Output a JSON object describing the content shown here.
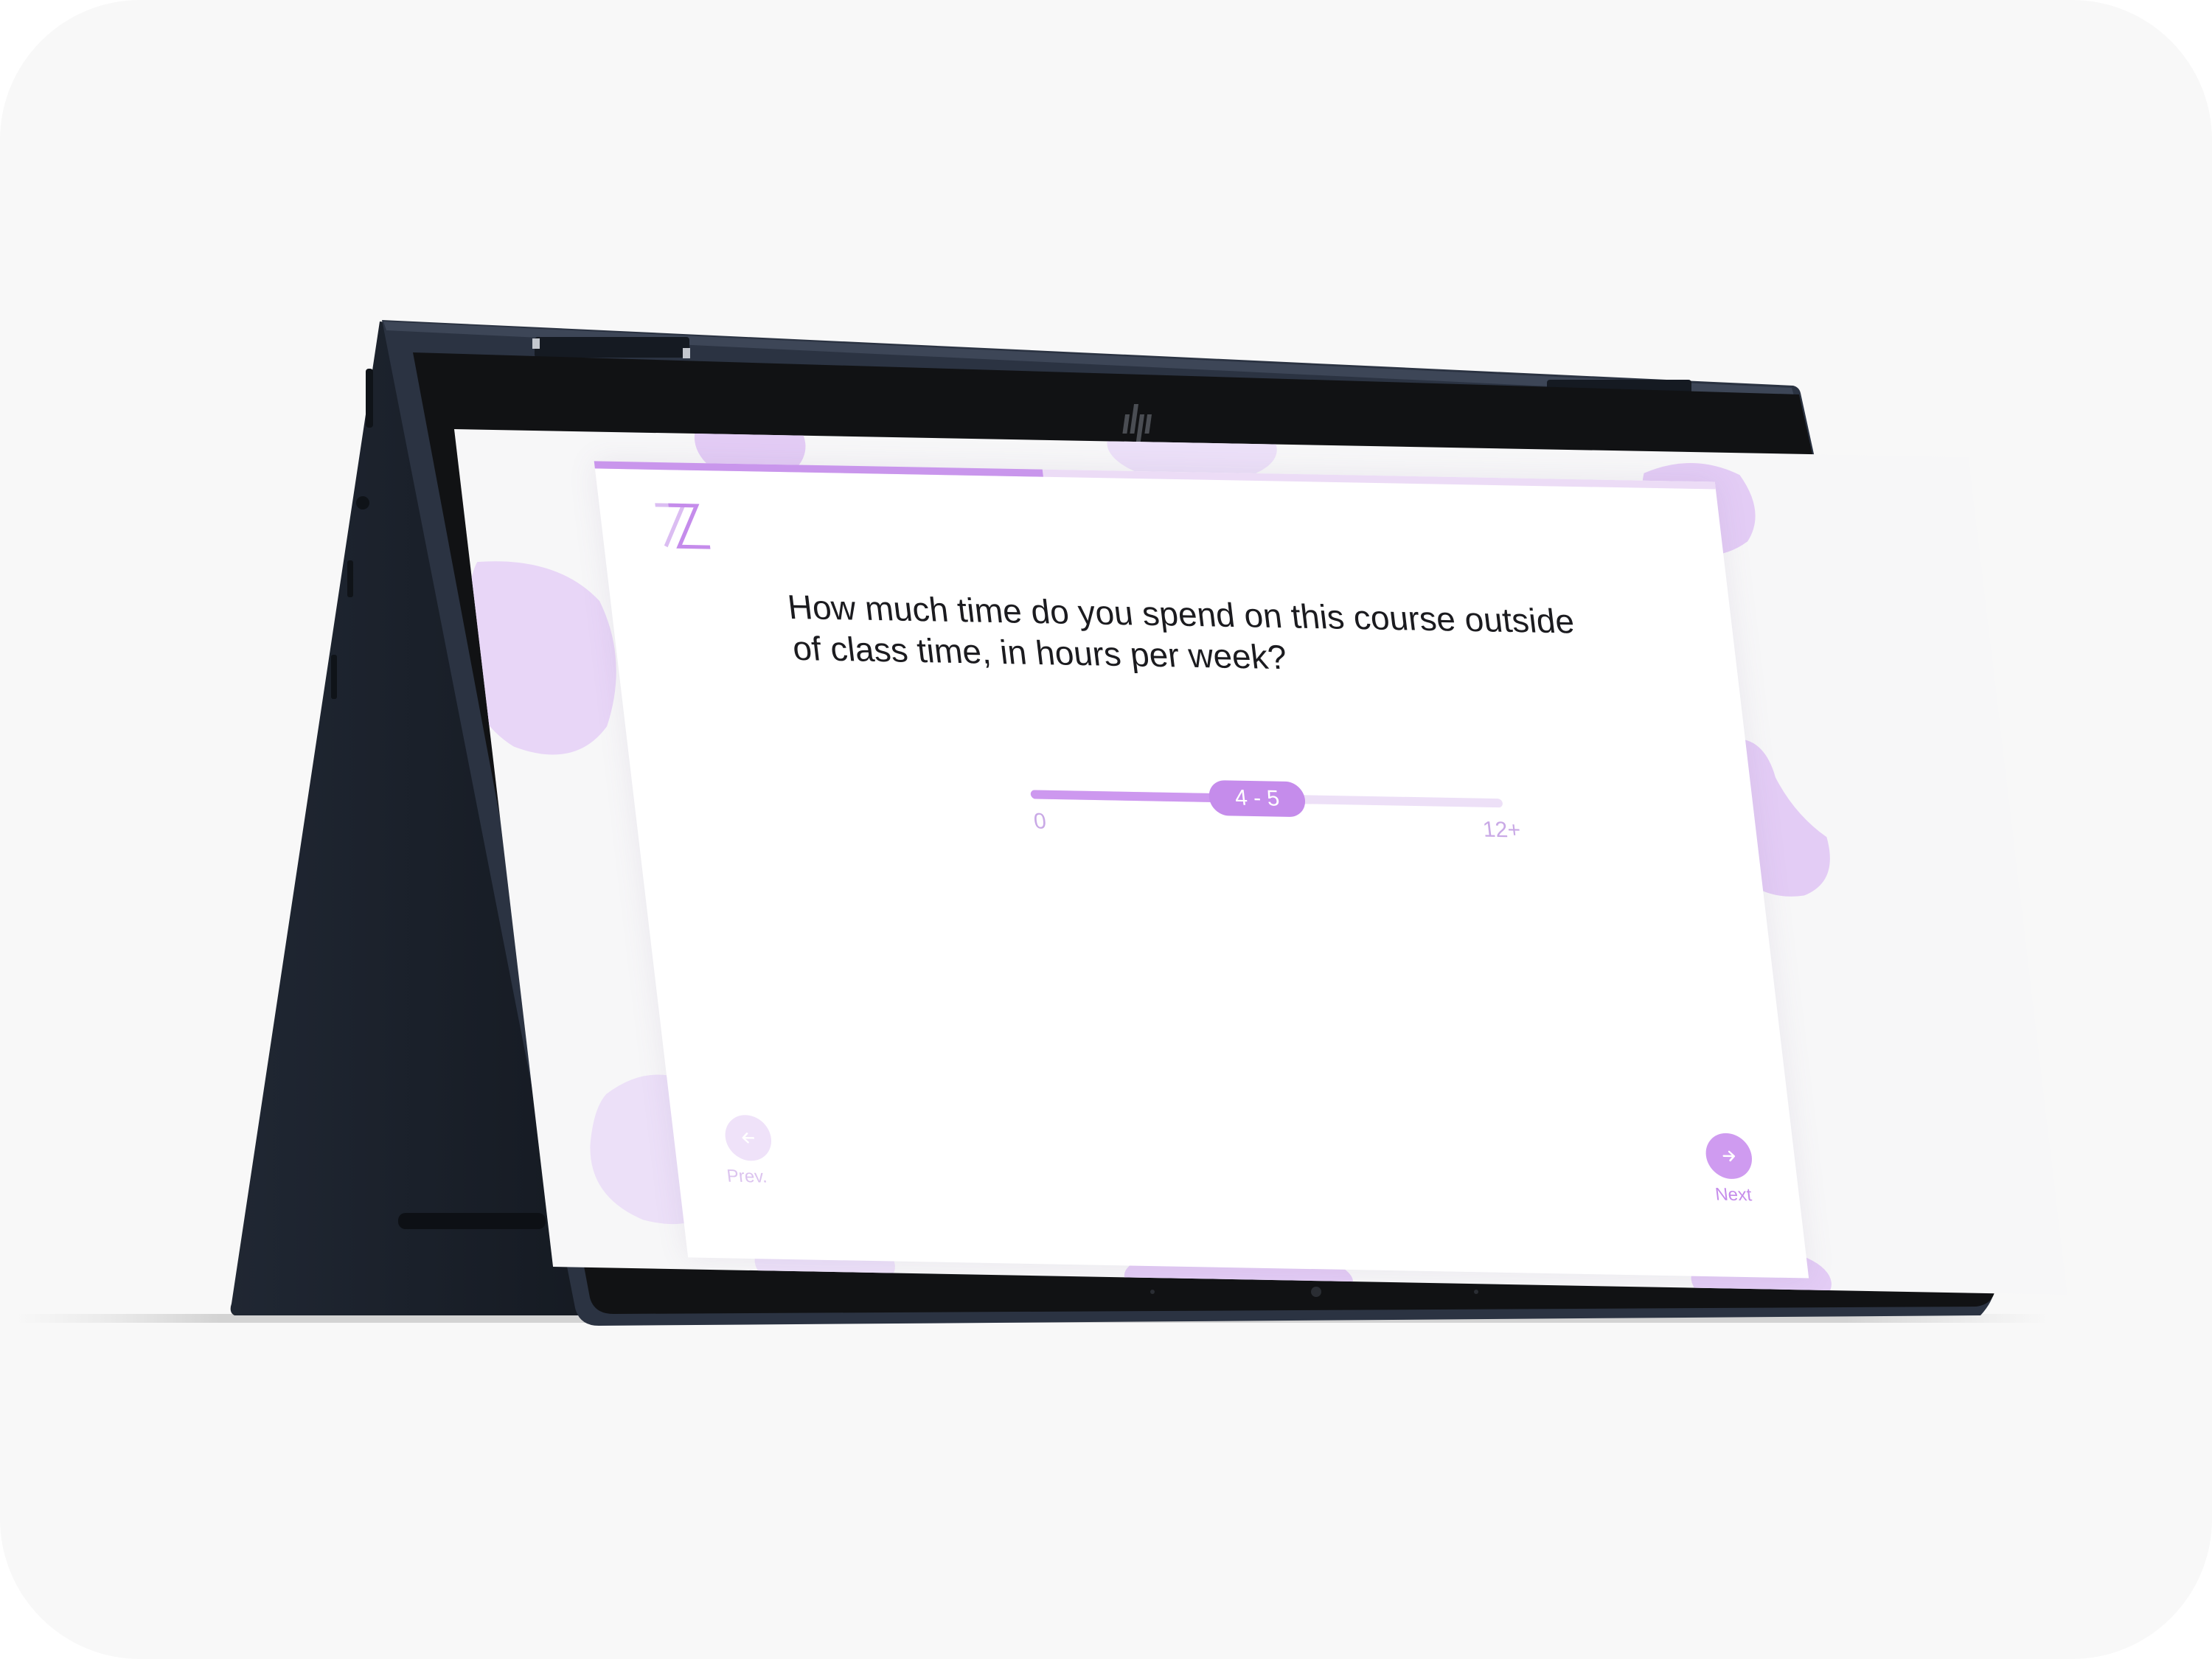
{
  "survey": {
    "question": "How much time do you spend on this course outside of class time, in hours per week?",
    "progress_percent": 40,
    "slider": {
      "min_label": "0",
      "max_label": "12+",
      "value_label": "4 - 5",
      "value_fraction": 0.48
    },
    "nav": {
      "prev_label": "Prev.",
      "next_label": "Next"
    }
  },
  "icons": {
    "logo": "z-logo",
    "prev": "arrow-left-icon",
    "next": "arrow-right-icon",
    "brand": "hp-logo"
  },
  "colors": {
    "accent": "#c58ceb",
    "accent_light": "#ede0f7",
    "blob": "#e3ccf5",
    "bezel": "#111214",
    "chassis": "#1e2530"
  }
}
